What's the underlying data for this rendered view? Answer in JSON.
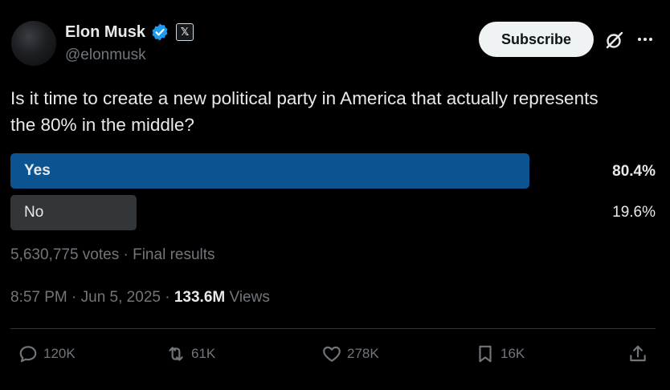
{
  "author": {
    "name": "Elon Musk",
    "handle": "@elonmusk",
    "badge_letter": "𝕏"
  },
  "subscribe_label": "Subscribe",
  "question": "Is it time to create a new political party in America that actually represents the 80% in the middle?",
  "poll": {
    "options": [
      {
        "label": "Yes",
        "percent_text": "80.4%",
        "percent": 80.4,
        "winner": true
      },
      {
        "label": "No",
        "percent_text": "19.6%",
        "percent": 19.6,
        "winner": false
      }
    ],
    "summary": "5,630,775 votes · Final results"
  },
  "meta": {
    "time_date": "8:57 PM · Jun 5, 2025 · ",
    "views_count": "133.6M",
    "views_label": " Views"
  },
  "actions": {
    "replies": "120K",
    "reposts": "61K",
    "likes": "278K",
    "bookmarks": "16K"
  },
  "icons": [
    "verified-icon",
    "x-logo-icon",
    "grok-icon",
    "more-icon",
    "reply-icon",
    "repost-icon",
    "like-icon",
    "bookmark-icon",
    "share-icon"
  ],
  "colors": {
    "background": "#000000",
    "poll_winner": "#0c5391",
    "poll_other": "#333639",
    "verified": "#1d9bf0"
  }
}
